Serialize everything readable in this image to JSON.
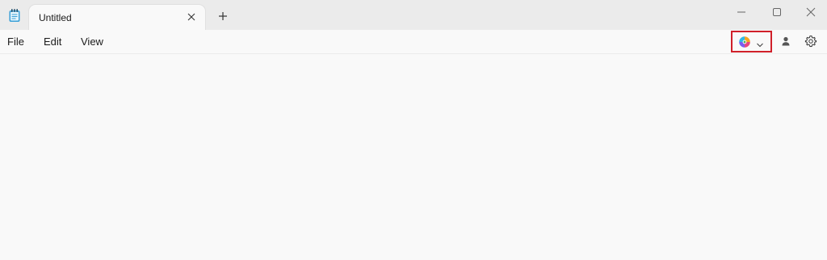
{
  "app": {
    "icon": "notepad-icon"
  },
  "tabs": [
    {
      "title": "Untitled",
      "active": true
    }
  ],
  "titlebar": {
    "new_tab_icon": "plus-icon",
    "minimize_icon": "minimize-icon",
    "maximize_icon": "maximize-icon",
    "close_icon": "close-icon"
  },
  "menu": {
    "file": "File",
    "edit": "Edit",
    "view": "View"
  },
  "toolbar": {
    "copilot_icon": "copilot-icon",
    "copilot_dropdown_icon": "chevron-down-icon",
    "account_icon": "account-icon",
    "settings_icon": "gear-icon",
    "highlight_color": "#d0202a"
  },
  "editor": {
    "content": ""
  }
}
